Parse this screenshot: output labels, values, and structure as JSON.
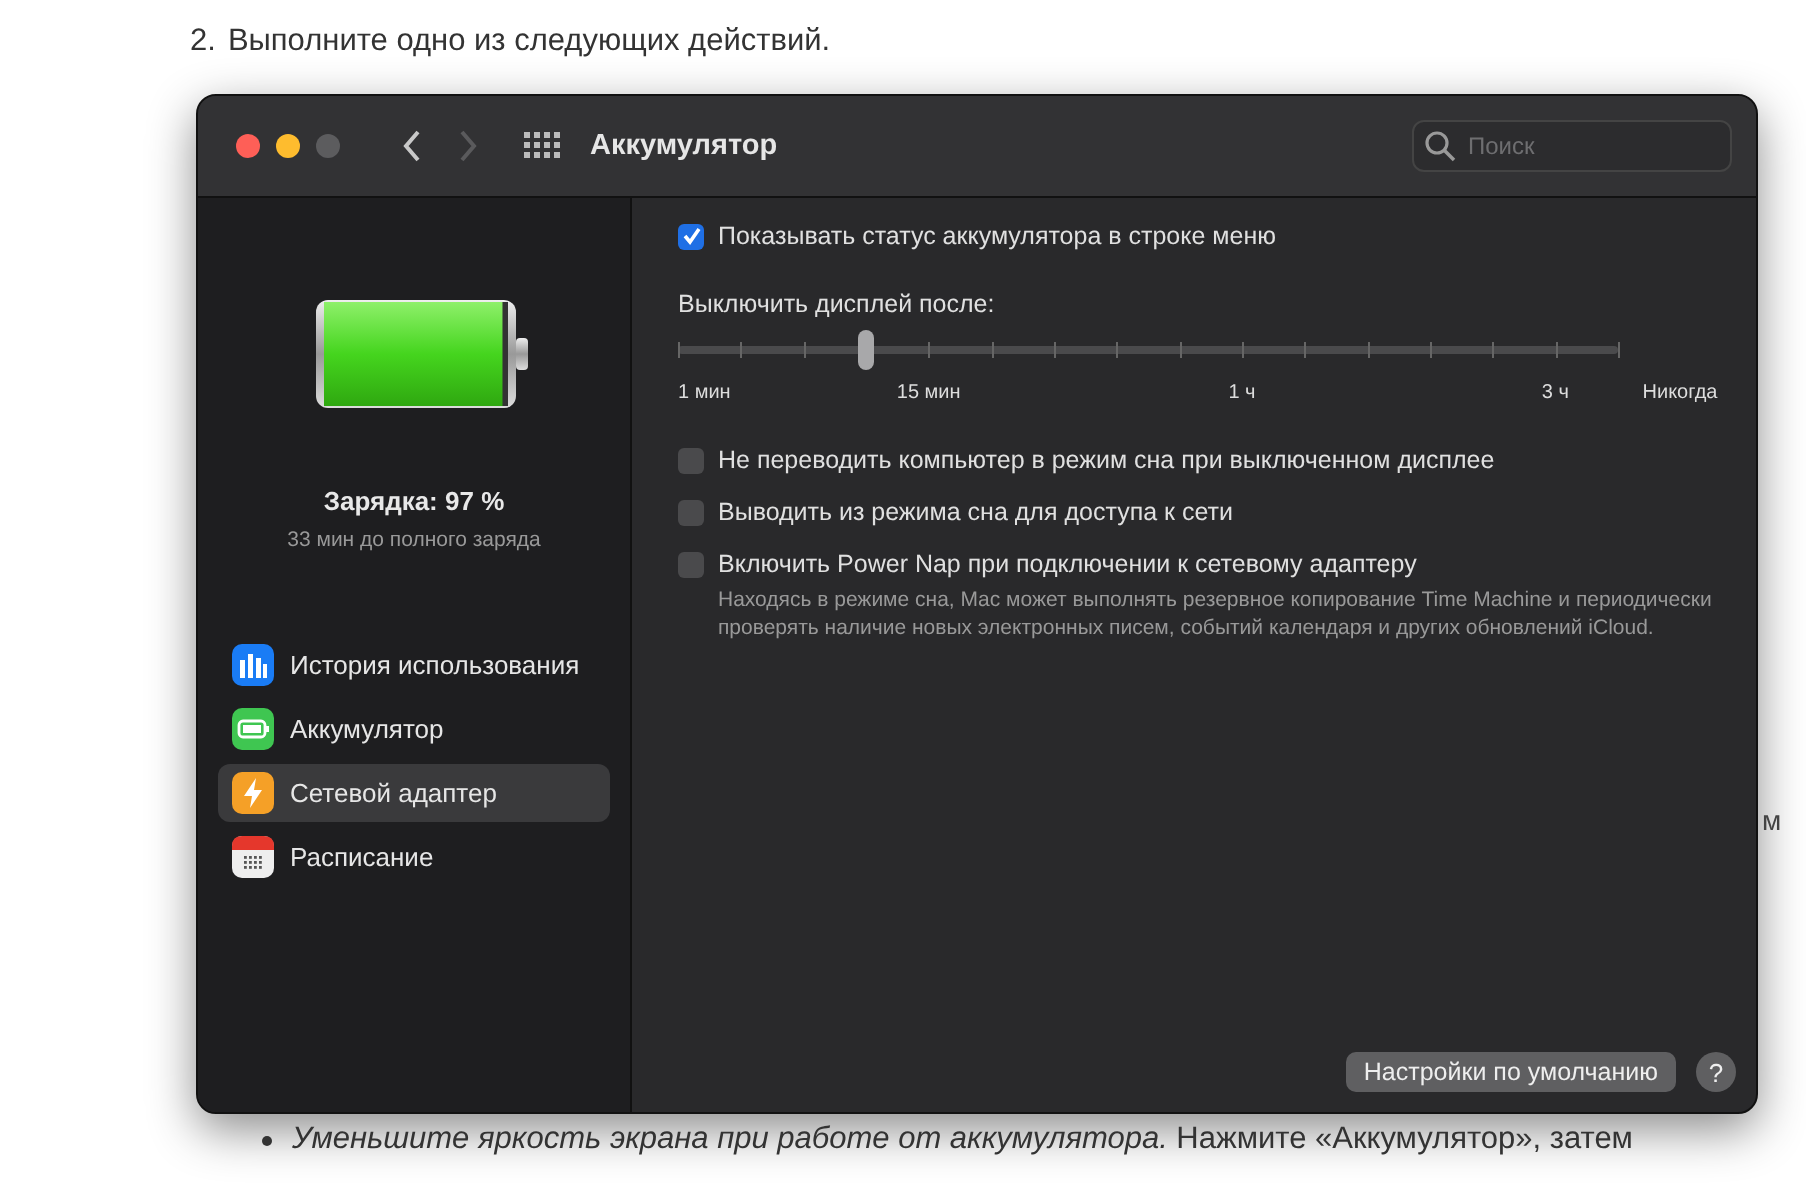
{
  "page": {
    "step_number": "2.",
    "step_text": "Выполните одно из следующих действий.",
    "bullet_text": "*Уменьшите яркость экрана при работе от аккумулятора.* Нажмите «Аккумулятор», затем",
    "edge_fragment": "м"
  },
  "window": {
    "title": "Аккумулятор",
    "search": {
      "placeholder": "Поиск"
    }
  },
  "battery": {
    "level": 0.97,
    "status": "Зарядка: 97 %",
    "detail": "33 мин до полного заряда"
  },
  "sidebar": {
    "items": [
      {
        "label": "История использования",
        "kind": "chart",
        "selected": false
      },
      {
        "label": "Аккумулятор",
        "kind": "battery",
        "selected": false
      },
      {
        "label": "Сетевой адаптер",
        "kind": "power",
        "selected": true
      },
      {
        "label": "Расписание",
        "kind": "calendar",
        "selected": false
      }
    ]
  },
  "settings": {
    "show_status": {
      "label": "Показывать статус аккумулятора в строке меню",
      "checked": true
    },
    "display_off": {
      "label": "Выключить дисплей после:",
      "level": 0.2,
      "ticks": [
        "1 мин",
        "15 мин",
        "1 ч",
        "3 ч",
        "Никогда"
      ]
    },
    "options": [
      {
        "label": "Не переводить компьютер в режим сна при выключенном дисплее",
        "checked": false
      },
      {
        "label": "Выводить из режима сна для доступа к сети",
        "checked": false
      },
      {
        "label": "Включить Power Nap при подключении к сетевому адаптеру",
        "checked": false,
        "note": "Находясь в режиме сна, Mac может выполнять резервное копирование Time Machine и периодически проверять наличие новых электронных писем, событий календаря и других обновлений iCloud."
      }
    ],
    "defaults_button": "Настройки по умолчанию",
    "help_button": "?"
  }
}
